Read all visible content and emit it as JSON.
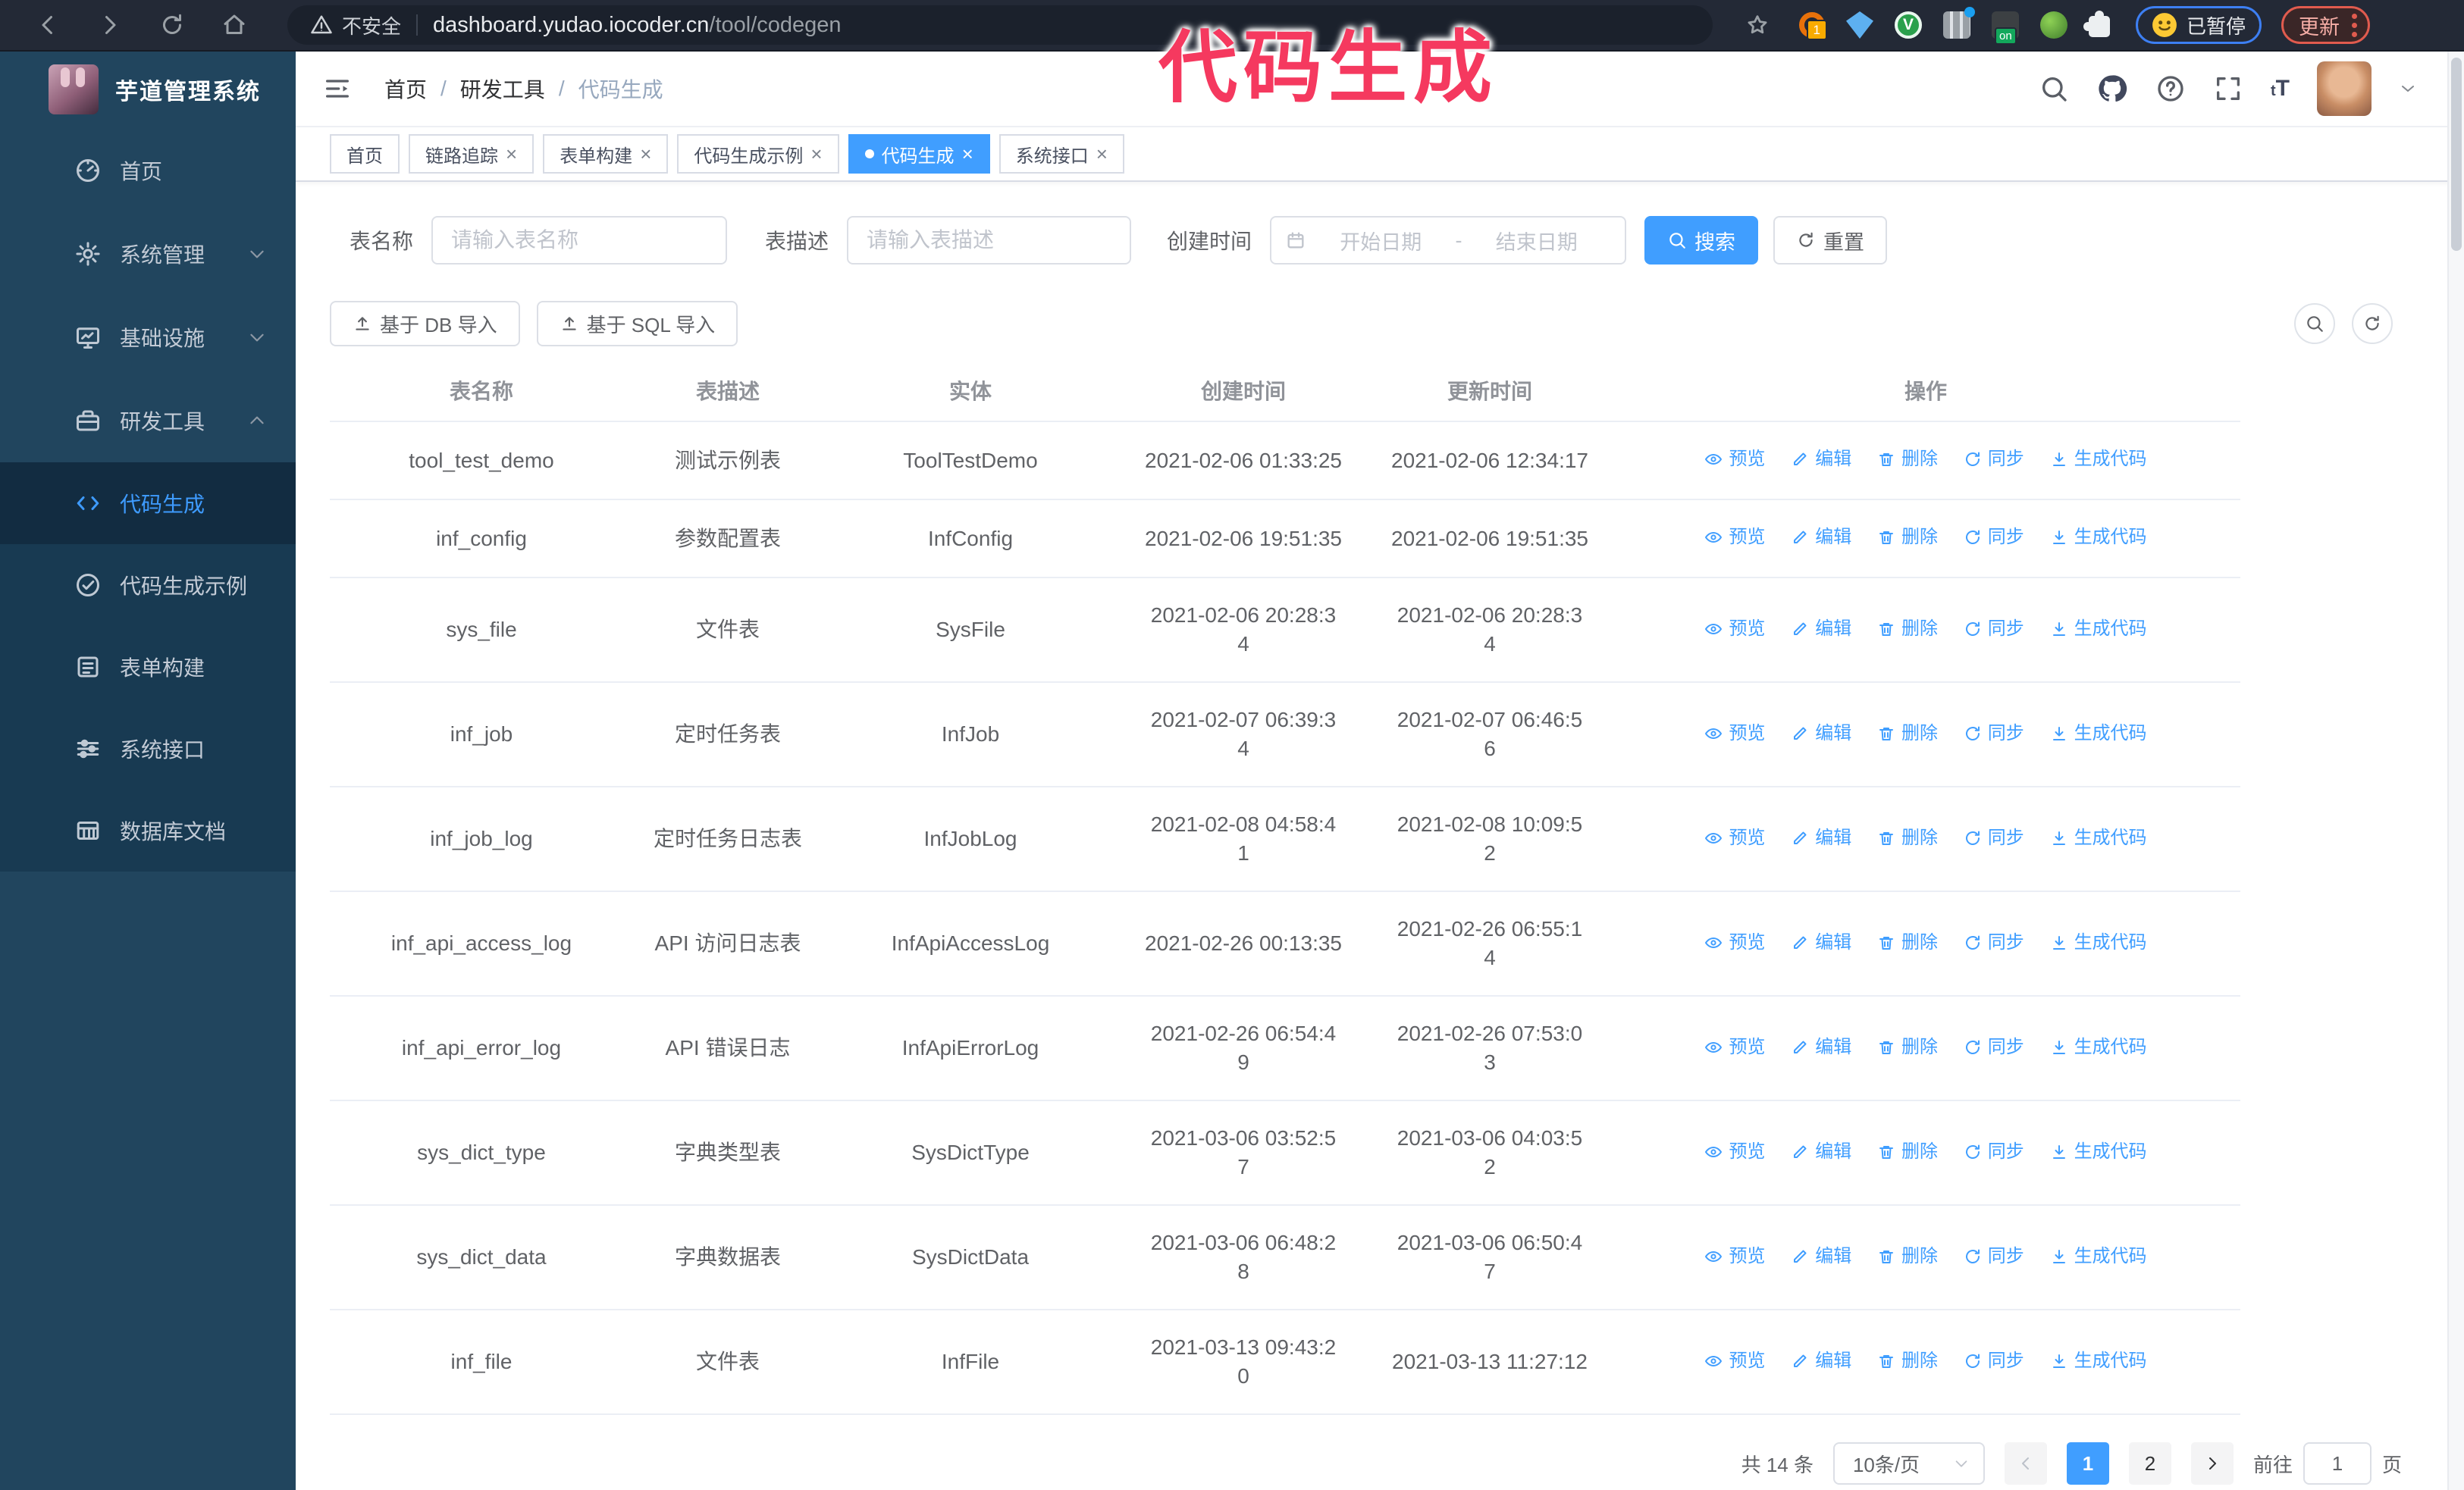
{
  "browser": {
    "security_label": "不安全",
    "url_host": "dashboard.yudao.iocoder.cn",
    "url_path": "/tool/codegen",
    "extension_badge_count": "1",
    "extension_badge_on": "on",
    "paused_badge": "已暂停",
    "update_button": "更新"
  },
  "annotation": {
    "text": "代码生成",
    "color": "#f5395f"
  },
  "sidebar": {
    "title": "芋道管理系统",
    "items": [
      {
        "label": "首页"
      },
      {
        "label": "系统管理"
      },
      {
        "label": "基础设施"
      },
      {
        "label": "研发工具"
      }
    ],
    "submenu": [
      {
        "label": "代码生成",
        "active": true
      },
      {
        "label": "代码生成示例"
      },
      {
        "label": "表单构建"
      },
      {
        "label": "系统接口"
      },
      {
        "label": "数据库文档"
      }
    ]
  },
  "breadcrumb": [
    "首页",
    "研发工具",
    "代码生成"
  ],
  "tabs": [
    {
      "label": "首页",
      "closable": false
    },
    {
      "label": "链路追踪",
      "closable": true
    },
    {
      "label": "表单构建",
      "closable": true
    },
    {
      "label": "代码生成示例",
      "closable": true
    },
    {
      "label": "代码生成",
      "closable": true,
      "active": true
    },
    {
      "label": "系统接口",
      "closable": true
    }
  ],
  "search": {
    "name_label": "表名称",
    "name_placeholder": "请输入表名称",
    "desc_label": "表描述",
    "desc_placeholder": "请输入表描述",
    "time_label": "创建时间",
    "start_placeholder": "开始日期",
    "range_separator": "-",
    "end_placeholder": "结束日期",
    "search_button": "搜索",
    "reset_button": "重置"
  },
  "toolbar": {
    "db_import": "基于 DB 导入",
    "sql_import": "基于 SQL 导入"
  },
  "table": {
    "columns": [
      "表名称",
      "表描述",
      "实体",
      "创建时间",
      "更新时间",
      "操作"
    ],
    "actions": [
      "预览",
      "编辑",
      "删除",
      "同步",
      "生成代码"
    ],
    "rows": [
      {
        "name": "tool_test_demo",
        "desc": "测试示例表",
        "entity": "ToolTestDemo",
        "create_time": "2021-02-06 01:33:25",
        "update_time": "2021-02-06 12:34:17"
      },
      {
        "name": "inf_config",
        "desc": "参数配置表",
        "entity": "InfConfig",
        "create_time": "2021-02-06 19:51:35",
        "update_time": "2021-02-06 19:51:35"
      },
      {
        "name": "sys_file",
        "desc": "文件表",
        "entity": "SysFile",
        "create_time": "2021-02-06 20:28:3\n4",
        "update_time": "2021-02-06 20:28:3\n4"
      },
      {
        "name": "inf_job",
        "desc": "定时任务表",
        "entity": "InfJob",
        "create_time": "2021-02-07 06:39:3\n4",
        "update_time": "2021-02-07 06:46:5\n6"
      },
      {
        "name": "inf_job_log",
        "desc": "定时任务日志表",
        "entity": "InfJobLog",
        "create_time": "2021-02-08 04:58:4\n1",
        "update_time": "2021-02-08 10:09:5\n2"
      },
      {
        "name": "inf_api_access_log",
        "desc": "API 访问日志表",
        "entity": "InfApiAccessLog",
        "create_time": "2021-02-26 00:13:35",
        "update_time": "2021-02-26 06:55:1\n4"
      },
      {
        "name": "inf_api_error_log",
        "desc": "API 错误日志",
        "entity": "InfApiErrorLog",
        "create_time": "2021-02-26 06:54:4\n9",
        "update_time": "2021-02-26 07:53:0\n3"
      },
      {
        "name": "sys_dict_type",
        "desc": "字典类型表",
        "entity": "SysDictType",
        "create_time": "2021-03-06 03:52:5\n7",
        "update_time": "2021-03-06 04:03:5\n2"
      },
      {
        "name": "sys_dict_data",
        "desc": "字典数据表",
        "entity": "SysDictData",
        "create_time": "2021-03-06 06:48:2\n8",
        "update_time": "2021-03-06 06:50:4\n7"
      },
      {
        "name": "inf_file",
        "desc": "文件表",
        "entity": "InfFile",
        "create_time": "2021-03-13 09:43:2\n0",
        "update_time": "2021-03-13 11:27:12"
      }
    ]
  },
  "pagination": {
    "total_text": "共 14 条",
    "page_size": "10条/页",
    "pages": [
      "1",
      "2"
    ],
    "current_page": "1",
    "goto_label": "前往",
    "goto_value": "1",
    "goto_suffix": "页"
  },
  "colors": {
    "accent": "#409eff",
    "annotation": "#f5395f",
    "sidebar_bg": "#21455e",
    "submenu_bg": "#183a52"
  }
}
